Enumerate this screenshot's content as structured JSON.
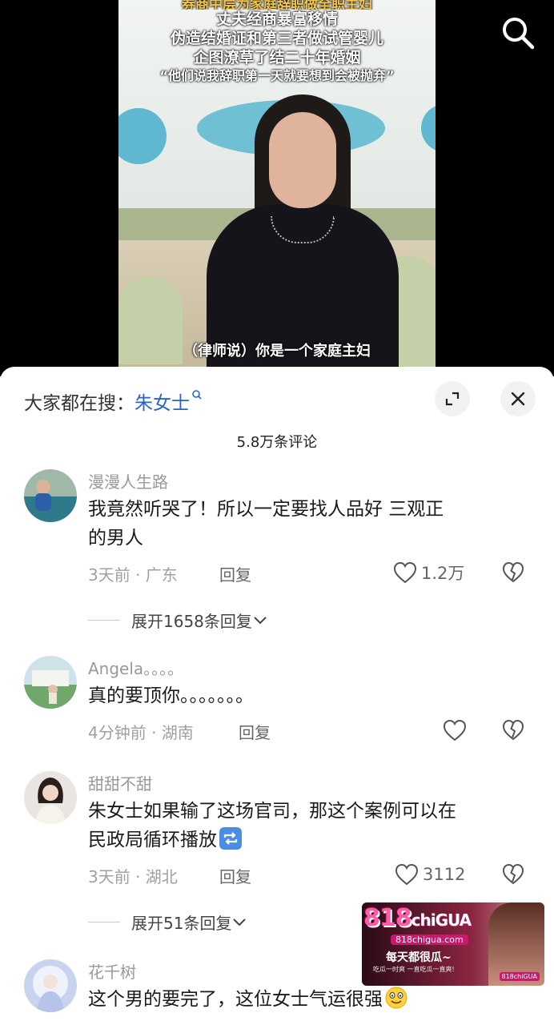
{
  "video": {
    "title_lines": [
      "券商中层为家庭辞职做全职主妇",
      "丈夫经商暴富移情",
      "伪造结婚证和第三者做试管婴儿",
      "企图潦草了结二十年婚姻",
      "“他们说我辞职第一天就要想到会被抛弃”"
    ],
    "subtitle": "（律师说）你是一个家庭主妇"
  },
  "sheet": {
    "search_prefix": "大家都在搜：",
    "search_keyword": "朱女士",
    "comment_count": "5.8万条评论"
  },
  "comments": [
    {
      "username": "漫漫人生路",
      "text_line1": "我竟然听哭了！所以一定要找人品好  三观正",
      "text_line2": "的男人",
      "time_location": "3天前 · 广东",
      "reply_label": "回复",
      "likes": "1.2万",
      "expand_label": "展开1658条回复"
    },
    {
      "username": "Angela。。。。",
      "text_line1": "真的要顶你。。。。。。。",
      "time_location": "4分钟前 · 湖南",
      "reply_label": "回复",
      "likes": ""
    },
    {
      "username": "甜甜不甜",
      "text_line1": "朱女士如果输了这场官司，那这个案例可以在",
      "text_line2": "民政局循环播放",
      "time_location": "3天前 · 湖北",
      "reply_label": "回复",
      "likes": "3112",
      "expand_label": "展开51条回复"
    },
    {
      "username": "花千树",
      "text_line1": "这个男的要完了，这位女士气运很强"
    }
  ],
  "ad": {
    "logo_num": "818",
    "logo_text": "chiGUA",
    "domain": "818chigua.com",
    "slogan": "每天都很瓜~",
    "sub": "吃瓜一时爽 一直吃瓜一直爽!",
    "tag": "818chiGUA"
  },
  "colors": {
    "keyword_blue": "#2a63c9",
    "meta_gray": "#a0a0a0",
    "sheet_bg": "#ffffff",
    "video_bg": "#000000"
  },
  "icons": [
    "search-icon",
    "expand-icon",
    "close-icon",
    "heart-icon",
    "dislike-heart-icon",
    "chevron-down-icon",
    "repeat-emoji",
    "smile-emoji"
  ]
}
